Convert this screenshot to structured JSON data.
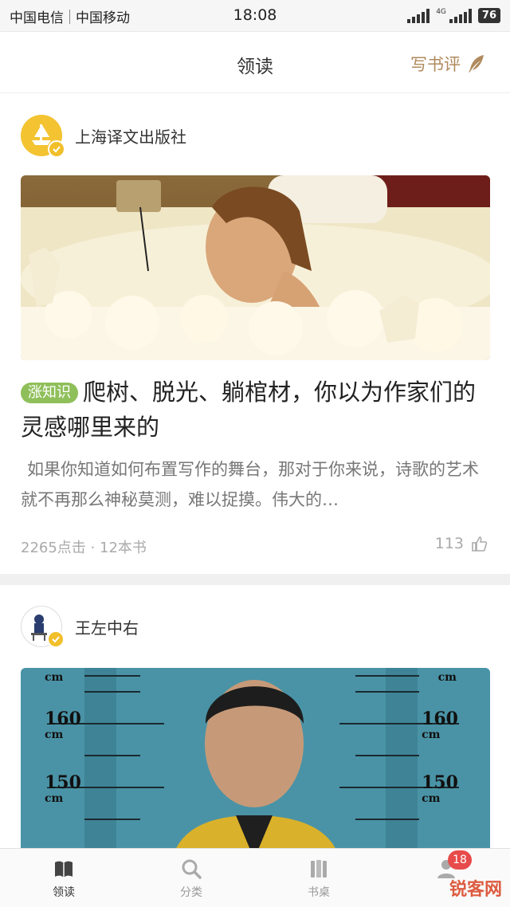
{
  "status_bar": {
    "carrier1": "中国电信",
    "carrier2": "中国移动",
    "time": "18:08",
    "network": "4G",
    "battery": "76"
  },
  "nav": {
    "title": "领读",
    "action_label": "写书评",
    "action_icon": "quill-icon"
  },
  "feed": [
    {
      "author": "上海译文出版社",
      "tag": "涨知识",
      "title": "爬树、脱光、躺棺材，你以为作家们的灵感哪里来的",
      "excerpt": "如果你知道如何布置写作的舞台，那对于你来说，诗歌的艺术就不再那么神秘莫测，难以捉摸。伟大的…",
      "clicks": "2265点击",
      "books": "12本书",
      "likes": "113"
    },
    {
      "author": "王左中右",
      "ruler_labels": [
        "160",
        "cm",
        "150",
        "cm",
        "cm"
      ]
    }
  ],
  "tabbar": {
    "tabs": [
      {
        "label": "领读",
        "icon": "book-icon"
      },
      {
        "label": "分类",
        "icon": "search-icon"
      },
      {
        "label": "书桌",
        "icon": "bookshelf-icon"
      },
      {
        "label": "",
        "icon": "profile-icon"
      }
    ],
    "badge": "18"
  },
  "watermark": "锐客网",
  "colors": {
    "accent": "#b08a5e",
    "tag_green": "#8fbf5a",
    "badge_red": "#e84b4b",
    "verified_yellow": "#f1bf2a"
  }
}
